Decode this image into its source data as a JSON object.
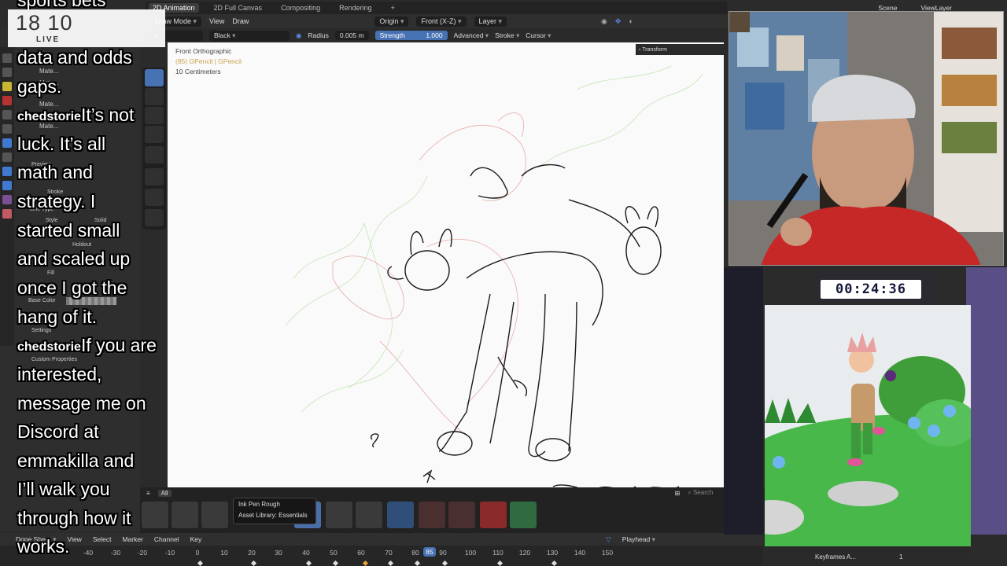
{
  "workspace_tabs": [
    "2D Animation",
    "2D Full Canvas",
    "Compositing",
    "Rendering"
  ],
  "header1": {
    "mode": "Draw Mode",
    "view": "View",
    "draw": "Draw",
    "origin": "Origin",
    "axis": "Front (X-Z)",
    "layer": "Layer"
  },
  "header2": {
    "color": "Black",
    "radius_label": "Radius",
    "radius_value": "0.005 m",
    "strength_label": "Strength",
    "strength_value": "1.000",
    "advanced": "Advanced",
    "stroke": "Stroke",
    "cursor": "Cursor"
  },
  "viewport": {
    "view_name": "Front Orthographic",
    "object": "(85) GPencil | GPencil",
    "scale": "10 Centimeters",
    "transform": "Transform"
  },
  "left_panel": {
    "materials": [
      "Mate...",
      "Mate...",
      "Mate...",
      "Mate..."
    ],
    "preview": "Preview",
    "stroke": "Stroke",
    "line_type": "Line Type",
    "style": "Style",
    "style_value": "Solid",
    "holdout": "Holdout",
    "fill": "Fill",
    "base_color": "Base Color",
    "settings": "Settings",
    "custom_properties": "Custom Properties"
  },
  "asset_shelf": {
    "tab": "All",
    "tooltip_title": "Ink Pen Rough",
    "tooltip_sub": "Asset Library: Essentials",
    "search": "Search"
  },
  "dopesheet": {
    "editor": "Dope Sheet",
    "menus": [
      "View",
      "Select",
      "Marker",
      "Channel",
      "Key"
    ],
    "playhead_label": "Playhead",
    "ticks": [
      "-40",
      "-30",
      "-20",
      "-10",
      "0",
      "10",
      "20",
      "30",
      "40",
      "50",
      "60",
      "70",
      "80",
      "90",
      "100",
      "110",
      "120",
      "130",
      "140",
      "150"
    ],
    "current_frame": "85",
    "keyframes_label": "Keyframes A...",
    "keyframes_value": "1"
  },
  "outliner": {
    "scene": "Scene",
    "view_layer": "ViewLayer"
  },
  "stream": {
    "clock_time": "18 10",
    "clock_live": "LIVE",
    "chat_line_top": "sports bets",
    "chat1_user": "chedstorie",
    "chat2_user": "chedstorie",
    "timer": "00:24:36"
  },
  "chat_lines": [
    "data and odds",
    "gaps.",
    "It’s not",
    "luck. It’s all",
    "math and",
    "strategy. I",
    "started small",
    "and scaled up",
    "once I got the",
    "hang of it.",
    "If you are",
    "interested,",
    "message me on",
    "Discord at",
    "emmakilla and",
    "I’ll walk you",
    "through how it",
    "works."
  ],
  "colors": {
    "accent": "#4772b3",
    "canvas": "#fafafa",
    "panel": "#2e2e2e"
  }
}
